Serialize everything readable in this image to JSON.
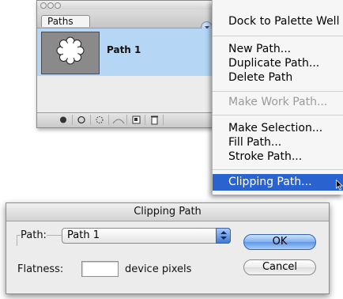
{
  "palette": {
    "tab_label": "Paths",
    "path_name": "Path 1",
    "footer_buttons": [
      {
        "name": "fill-path-icon"
      },
      {
        "name": "stroke-path-icon"
      },
      {
        "name": "load-selection-icon"
      },
      {
        "name": "make-work-path-icon"
      },
      {
        "name": "new-path-icon"
      },
      {
        "name": "delete-path-icon"
      }
    ]
  },
  "menu": {
    "items": [
      {
        "label": "Dock to Palette Well",
        "state": "enabled"
      },
      {
        "label": "New Path...",
        "state": "enabled"
      },
      {
        "label": "Duplicate Path...",
        "state": "enabled"
      },
      {
        "label": "Delete Path",
        "state": "enabled"
      },
      {
        "label": "Make Work Path...",
        "state": "disabled"
      },
      {
        "label": "Make Selection...",
        "state": "enabled"
      },
      {
        "label": "Fill Path...",
        "state": "enabled"
      },
      {
        "label": "Stroke Path...",
        "state": "enabled"
      },
      {
        "label": "Clipping Path...",
        "state": "selected"
      }
    ]
  },
  "dialog": {
    "title": "Clipping Path",
    "path_label": "Path:",
    "path_value": "Path 1",
    "flatness_label": "Flatness:",
    "flatness_value": "",
    "flatness_units": "device pixels",
    "ok_label": "OK",
    "cancel_label": "Cancel"
  },
  "colors": {
    "selection_highlight": "#2a63cf",
    "path_row_highlight": "#b6d6f5",
    "ok_button": "#5d98e6"
  }
}
